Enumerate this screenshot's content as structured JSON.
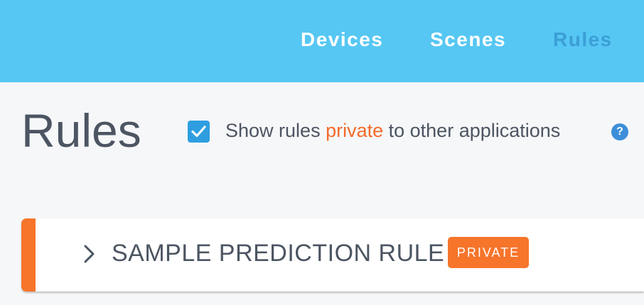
{
  "nav": {
    "items": [
      {
        "label": "Devices",
        "active": false
      },
      {
        "label": "Scenes",
        "active": false
      },
      {
        "label": "Rules",
        "active": true
      }
    ]
  },
  "page": {
    "title": "Rules",
    "visibility_toggle": {
      "checked": true,
      "label_before": "Show rules ",
      "label_highlight": "private",
      "label_after": " to other applications",
      "help_icon": "?"
    }
  },
  "rules": [
    {
      "name": "SAMPLE PREDICTION RULE",
      "badge": "PRIVATE",
      "expanded": false,
      "icon": "chevron-right-icon"
    }
  ],
  "colors": {
    "nav_bg": "#56c7f3",
    "nav_active": "#3b9fd6",
    "accent_orange": "#f7742b",
    "checkbox_blue": "#2e9ee0",
    "text_dark": "#4c5562",
    "page_bg": "#f6f7f9"
  }
}
